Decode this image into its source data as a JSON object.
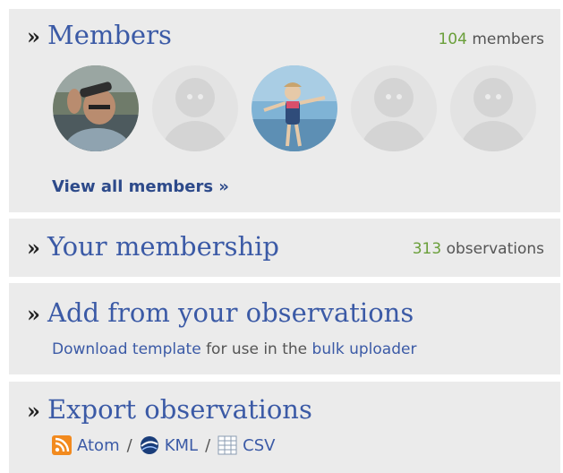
{
  "members": {
    "title": "Members",
    "count": "104",
    "count_suffix": "members",
    "avatars": [
      "user-photo-1",
      "default-avatar",
      "user-photo-2",
      "default-avatar",
      "default-avatar"
    ],
    "view_all": "View all members »"
  },
  "membership": {
    "title": "Your membership",
    "count": "313",
    "count_suffix": "observations"
  },
  "add": {
    "title": "Add from your observations",
    "download_link": "Download template",
    "middle_text": "for use in the",
    "uploader_link": "bulk uploader"
  },
  "export": {
    "title": "Export observations",
    "atom": "Atom",
    "kml": "KML",
    "csv": "CSV",
    "separator": "/"
  },
  "chevron": "»",
  "colors": {
    "panel_bg": "#ebebeb",
    "title_blue": "#3b5aa6",
    "count_green": "#6a9f3a"
  }
}
